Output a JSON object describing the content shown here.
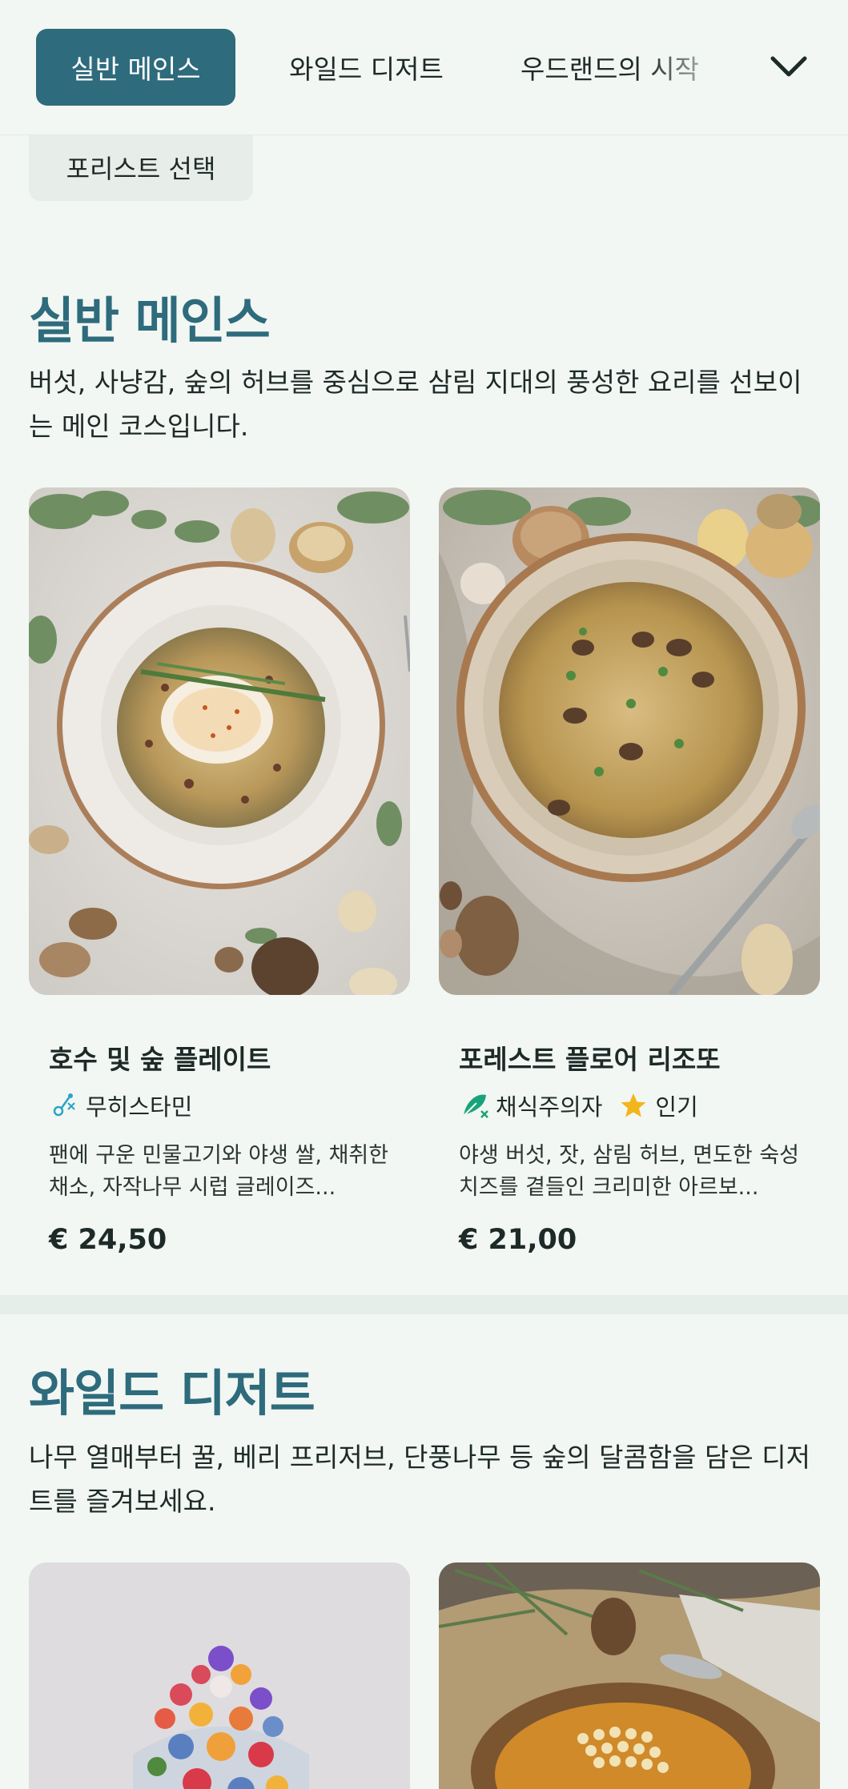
{
  "nav": {
    "tabs": [
      {
        "label": "실반 메인스",
        "active": true
      },
      {
        "label": "와일드 디저트",
        "active": false
      },
      {
        "label": "우드랜드의 시작",
        "active": false
      }
    ],
    "more_icon": "chevron-down-icon"
  },
  "chip": {
    "label": "포리스트 선택"
  },
  "sections": [
    {
      "title": "실반 메인스",
      "description": "버섯, 사냥감, 숲의 허브를 중심으로 삼림 지대의 풍성한 요리를 선보이는 메인 코스입니다.",
      "items": [
        {
          "name": "호수 및 숲 플레이트",
          "tags": [
            {
              "icon": "histamine-free-icon",
              "label": "무히스타민"
            }
          ],
          "description": "팬에 구운 민물고기와 야생 쌀, 채취한 채소, 자작나무 시럽 글레이즈...",
          "price": "€ 24,50"
        },
        {
          "name": "포레스트 플로어 리조또",
          "tags": [
            {
              "icon": "vegetarian-icon",
              "label": "채식주의자"
            },
            {
              "icon": "star-icon",
              "label": "인기"
            }
          ],
          "description": "야생 버섯, 잣, 삼림 허브, 면도한 숙성 치즈를 곁들인 크리미한 아르보...",
          "price": "€ 21,00"
        }
      ]
    },
    {
      "title": "와일드 디저트",
      "description": "나무 열매부터 꿀, 베리 프리저브, 단풍나무 등 숲의 달콤함을 담은 디저트를 즐겨보세요."
    }
  ],
  "colors": {
    "accent": "#2e6b7c",
    "background": "#f2f7f3",
    "vegetarian": "#1aa37a",
    "star": "#f2b51c",
    "histamine": "#29a3c9"
  }
}
